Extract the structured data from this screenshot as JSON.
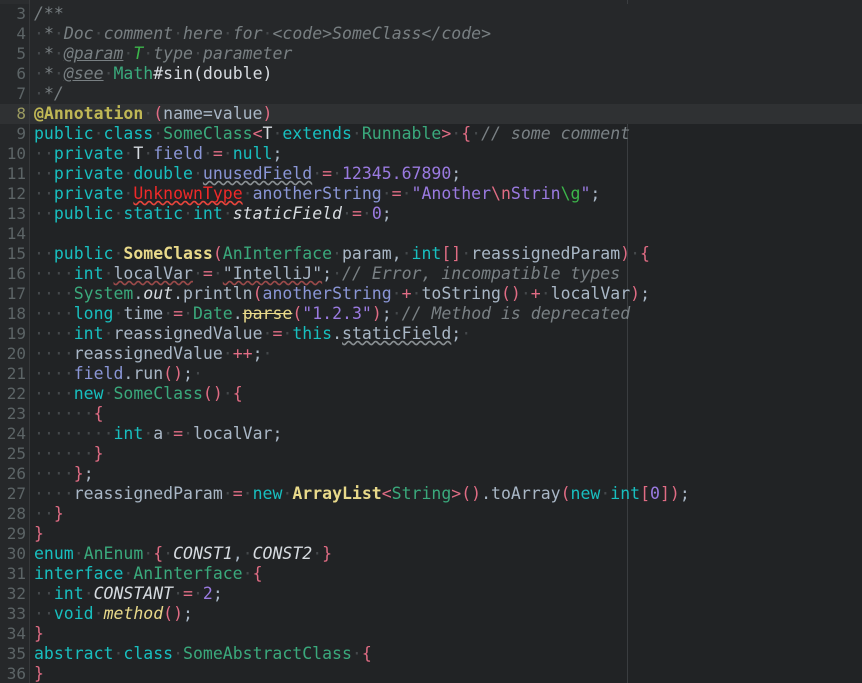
{
  "editor": {
    "language": "Java",
    "theme_name": "Darcula",
    "first_visible_line": 3,
    "last_visible_line": 36,
    "caret_line": 8,
    "right_margin_column_guide": true,
    "show_whitespace_dots": true,
    "colors": {
      "background": "#212325",
      "gutter_background": "#26282a",
      "gutter_separator": "#37393b",
      "line_number": "#5c6466",
      "caret_row_background": "#2f3133",
      "doc_block_background": "#26282a",
      "right_margin_guide": "#3a3d40",
      "default_text": "#a9b7c6",
      "keyword": "#18bfbf",
      "doc_comment": "#787f82",
      "line_comment": "#7a8185",
      "annotation": "#bfb755",
      "class_name": "#3aa97c",
      "string": "#9a7ae0",
      "number": "#9a7ae0",
      "braces_and_operators": "#e06c84",
      "constructor_call": "#e8d98a",
      "instance_field": "#8a96d6",
      "static_field": "#d6dbe0",
      "unknown_symbol_error": "#ef2929",
      "valid_escape_sequence": "#e06c84",
      "invalid_escape_sequence": "#3cb54a",
      "error_stripe_wave": "#e8453c",
      "warning_wave": "#8a9093",
      "typo_wave": "#9a4a4a"
    },
    "lines": [
      {
        "n": 3,
        "text": "/**"
      },
      {
        "n": 4,
        "text": " * Doc comment here for <code>SomeClass</code>"
      },
      {
        "n": 5,
        "text": " * @param T type parameter"
      },
      {
        "n": 6,
        "text": " * @see Math#sin(double)"
      },
      {
        "n": 7,
        "text": " */"
      },
      {
        "n": 8,
        "text": "@Annotation (name=value)"
      },
      {
        "n": 9,
        "text": "public class SomeClass<T extends Runnable> { // some comment"
      },
      {
        "n": 10,
        "text": "  private T field = null;"
      },
      {
        "n": 11,
        "text": "  private double unusedField = 12345.67890;"
      },
      {
        "n": 12,
        "text": "  private UnknownType anotherString = \"Another\\nStrin\\g\";"
      },
      {
        "n": 13,
        "text": "  public static int staticField = 0;"
      },
      {
        "n": 14,
        "text": ""
      },
      {
        "n": 15,
        "text": "  public SomeClass(AnInterface param, int[] reassignedParam) {"
      },
      {
        "n": 16,
        "text": "    int localVar = \"IntelliJ\"; // Error, incompatible types"
      },
      {
        "n": 17,
        "text": "    System.out.println(anotherString + toString() + localVar);"
      },
      {
        "n": 18,
        "text": "    long time = Date.parse(\"1.2.3\"); // Method is deprecated"
      },
      {
        "n": 19,
        "text": "    int reassignedValue = this.staticField; "
      },
      {
        "n": 20,
        "text": "    reassignedValue ++; "
      },
      {
        "n": 21,
        "text": "    field.run(); "
      },
      {
        "n": 22,
        "text": "    new SomeClass() {"
      },
      {
        "n": 23,
        "text": "      {"
      },
      {
        "n": 24,
        "text": "        int a = localVar;"
      },
      {
        "n": 25,
        "text": "      }"
      },
      {
        "n": 26,
        "text": "    };"
      },
      {
        "n": 27,
        "text": "    reassignedParam = new ArrayList<String>().toArray(new int[0]);"
      },
      {
        "n": 28,
        "text": "  }"
      },
      {
        "n": 29,
        "text": "}"
      },
      {
        "n": 30,
        "text": "enum AnEnum { CONST1, CONST2 }"
      },
      {
        "n": 31,
        "text": "interface AnInterface {"
      },
      {
        "n": 32,
        "text": "  int CONSTANT = 2;"
      },
      {
        "n": 33,
        "text": "  void method();"
      },
      {
        "n": 34,
        "text": "}"
      },
      {
        "n": 35,
        "text": "abstract class SomeAbstractClass {"
      },
      {
        "n": 36,
        "text": "}"
      }
    ],
    "line_numbers": {
      "l3": "3",
      "l4": "4",
      "l5": "5",
      "l6": "6",
      "l7": "7",
      "l8": "8",
      "l9": "9",
      "l10": "10",
      "l11": "11",
      "l12": "12",
      "l13": "13",
      "l14": "14",
      "l15": "15",
      "l16": "16",
      "l17": "17",
      "l18": "18",
      "l19": "19",
      "l20": "20",
      "l21": "21",
      "l22": "22",
      "l23": "23",
      "l24": "24",
      "l25": "25",
      "l26": "26",
      "l27": "27",
      "l28": "28",
      "l29": "29",
      "l30": "30",
      "l31": "31",
      "l32": "32",
      "l33": "33",
      "l34": "34",
      "l35": "35",
      "l36": "36"
    },
    "tokens": {
      "dot": "·",
      "l3_c1": "/**",
      "l4_c1": "*",
      "l4_c2": "Doc",
      "l4_c3": "comment",
      "l4_c4": "here",
      "l4_c5": "for",
      "l4_c6": "<code>SomeClass</code>",
      "l5_c1": "*",
      "l5_c2": "@param",
      "l5_c3": "T",
      "l5_c4": "type",
      "l5_c5": "parameter",
      "l6_c1": "*",
      "l6_c2": "@see",
      "l6_c3": "Math",
      "l6_c4": "#sin(double)",
      "l7_c1": "*/",
      "l8_c1": "@Annotation",
      "l8_c2": "(",
      "l8_c3": "name=value",
      "l8_c4": ")",
      "l9_c1": "public",
      "l9_c2": "class",
      "l9_c3": "SomeClass",
      "l9_c4": "<",
      "l9_c5": "T",
      "l9_c6": "extends",
      "l9_c7": "Runnable",
      "l9_c8": ">",
      "l9_c9": "{",
      "l9_c10": "// some comment",
      "l10_c1": "private",
      "l10_c2": "T",
      "l10_c3": "field",
      "l10_c4": "=",
      "l10_c5": "null",
      "l10_c6": ";",
      "l11_c1": "private",
      "l11_c2": "double",
      "l11_c3": "unusedField",
      "l11_c4": "=",
      "l11_c5": "12345.67890",
      "l11_c6": ";",
      "l12_c1": "private",
      "l12_c2": "UnknownType",
      "l12_c3": "anotherString",
      "l12_c4": "=",
      "l12_c5": "\"Another",
      "l12_c6": "\\n",
      "l12_c7": "Strin",
      "l12_c8": "\\g",
      "l12_c9": "\"",
      "l12_c10": ";",
      "l13_c1": "public",
      "l13_c2": "static",
      "l13_c3": "int",
      "l13_c4": "staticField",
      "l13_c5": "=",
      "l13_c6": "0",
      "l13_c7": ";",
      "l15_c1": "public",
      "l15_c2": "SomeClass",
      "l15_c3": "(",
      "l15_c4": "AnInterface",
      "l15_c5": "param",
      "l15_c6": ",",
      "l15_c7": "int",
      "l15_c8": "[]",
      "l15_c9": "reassignedParam",
      "l15_c10": ")",
      "l15_c11": "{",
      "l16_c1": "int",
      "l16_c2": "localVar",
      "l16_c3": "=",
      "l16_c4": "\"IntelliJ\"",
      "l16_c5": ";",
      "l16_c6": "// Error, incompatible types",
      "l17_c1": "System",
      "l17_c2": ".",
      "l17_c3": "out",
      "l17_c4": ".",
      "l17_c5": "println",
      "l17_c6": "(",
      "l17_c7": "anotherString",
      "l17_c8": "+",
      "l17_c9": "toString",
      "l17_c10": "()",
      "l17_c11": "+",
      "l17_c12": "localVar",
      "l17_c13": ")",
      "l17_c14": ";",
      "l18_c1": "long",
      "l18_c2": "time",
      "l18_c3": "=",
      "l18_c4": "Date",
      "l18_c5": ".",
      "l18_c6": "parse",
      "l18_c7": "(",
      "l18_c8": "\"1.2.3\"",
      "l18_c9": ")",
      "l18_c10": ";",
      "l18_c11": "// Method is deprecated",
      "l19_c1": "int",
      "l19_c2": "reassignedValue",
      "l19_c3": "=",
      "l19_c4": "this",
      "l19_c5": ".",
      "l19_c6": "staticField",
      "l19_c7": ";",
      "l20_c1": "reassignedValue",
      "l20_c2": "++",
      "l20_c3": ";",
      "l21_c1": "field",
      "l21_c2": ".",
      "l21_c3": "run",
      "l21_c4": "()",
      "l21_c5": ";",
      "l22_c1": "new",
      "l22_c2": "SomeClass",
      "l22_c3": "()",
      "l22_c4": "{",
      "l23_c1": "{",
      "l24_c1": "int",
      "l24_c2": "a",
      "l24_c3": "=",
      "l24_c4": "localVar",
      "l24_c5": ";",
      "l25_c1": "}",
      "l26_c1": "}",
      "l26_c2": ";",
      "l27_c1": "reassignedParam",
      "l27_c2": "=",
      "l27_c3": "new",
      "l27_c4": "ArrayList",
      "l27_c5": "<",
      "l27_c6": "String",
      "l27_c7": ">",
      "l27_c8": "()",
      "l27_c9": ".",
      "l27_c10": "toArray",
      "l27_c11": "(",
      "l27_c12": "new",
      "l27_c13": "int",
      "l27_c14": "[",
      "l27_c15": "0",
      "l27_c16": "]",
      "l27_c17": ")",
      "l27_c18": ";",
      "l28_c1": "}",
      "l29_c1": "}",
      "l30_c1": "enum",
      "l30_c2": "AnEnum",
      "l30_c3": "{",
      "l30_c4": "CONST1",
      "l30_c5": ",",
      "l30_c6": "CONST2",
      "l30_c7": "}",
      "l31_c1": "interface",
      "l31_c2": "AnInterface",
      "l31_c3": "{",
      "l32_c1": "int",
      "l32_c2": "CONSTANT",
      "l32_c3": "=",
      "l32_c4": "2",
      "l32_c5": ";",
      "l33_c1": "void",
      "l33_c2": "method",
      "l33_c3": "()",
      "l33_c4": ";",
      "l34_c1": "}",
      "l35_c1": "abstract",
      "l35_c2": "class",
      "l35_c3": "SomeAbstractClass",
      "l35_c4": "{",
      "l36_c1": "}"
    }
  }
}
